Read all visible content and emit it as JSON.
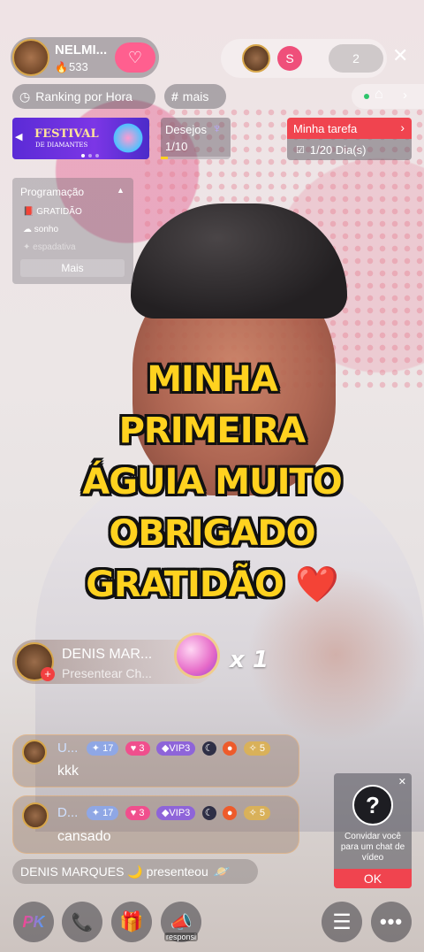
{
  "host": {
    "name": "NELMI...",
    "followers": "533"
  },
  "viewers": {
    "badge_letter": "S",
    "count": "2"
  },
  "tags": {
    "ranking": "Ranking por Hora",
    "hashtag": "mais"
  },
  "banner": {
    "line1": "FESTIVAL",
    "line2": "DE DIAMANTES"
  },
  "wishes": {
    "label": "Desejos",
    "progress": "1/10",
    "fraction": 0.1
  },
  "task": {
    "title": "Minha tarefa",
    "progress": "1/20 Dia(s)"
  },
  "schedule": {
    "title": "Programação",
    "items": [
      "GRATIDÃO",
      "sonho",
      "espadativa"
    ],
    "more": "Mais"
  },
  "overlay": {
    "lines": [
      "MINHA",
      "PRIMEIRA",
      "ÁGUIA MUITO",
      "OBRIGADO",
      "GRATIDÃO"
    ],
    "heart": "❤️"
  },
  "gift": {
    "sender": "DENIS MAR...",
    "action": "Presentear Ch...",
    "count": "x 1"
  },
  "messages": [
    {
      "user": "U...",
      "level": "17",
      "hearts": "3",
      "vip": "VIP3",
      "fans": "5",
      "text": "kkk"
    },
    {
      "user": "D...",
      "level": "17",
      "hearts": "3",
      "vip": "VIP3",
      "fans": "5",
      "text": "cansado"
    }
  ],
  "notice": {
    "text": "DENIS MARQUES 🌙 presenteou"
  },
  "invite": {
    "text": "Convidar você para um chat de vídeo",
    "ok": "OK"
  },
  "bottom": {
    "pk": "PK",
    "response": "responsi"
  }
}
